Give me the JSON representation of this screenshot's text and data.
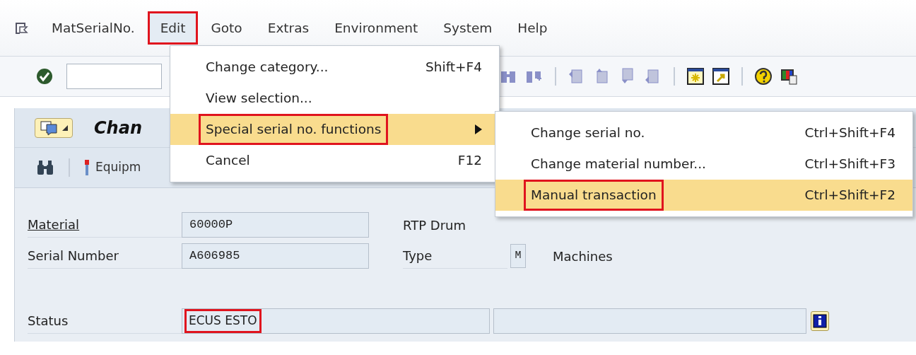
{
  "menu_bar": [
    {
      "label": "MatSerialNo.",
      "open": false
    },
    {
      "label": "Edit",
      "open": true,
      "annotated": true
    },
    {
      "label": "Goto",
      "open": false
    },
    {
      "label": "Extras",
      "open": false
    },
    {
      "label": "Environment",
      "open": false
    },
    {
      "label": "System",
      "open": false
    },
    {
      "label": "Help",
      "open": false
    }
  ],
  "title": "Chan",
  "app_toolbar": {
    "button": "Equipm"
  },
  "form": {
    "rows": [
      {
        "label": "Material",
        "underlined": true,
        "value": "60000P",
        "side_label": "RTP Drum"
      },
      {
        "label": "Serial Number",
        "underlined": false,
        "value": "A606985",
        "side_label": "Type",
        "code": "M",
        "code_text": "Machines"
      }
    ],
    "status": {
      "label": "Status",
      "value": "ECUS ESTO",
      "annotated": true
    }
  },
  "edit_menu": [
    {
      "label": "Change category...",
      "shortcut": "Shift+F4",
      "selected": false,
      "annotated": false,
      "submenu": false
    },
    {
      "label": "View selection...",
      "selected": false,
      "annotated": false,
      "submenu": false
    },
    {
      "label": "Special serial no. functions",
      "selected": true,
      "annotated": true,
      "submenu": true
    },
    {
      "label": "Cancel",
      "shortcut": "F12",
      "selected": false,
      "annotated": false,
      "submenu": false
    }
  ],
  "submenu": [
    {
      "label": "Change serial no.",
      "shortcut": "Ctrl+Shift+F4",
      "selected": false,
      "annotated": false
    },
    {
      "label": "Change material number...",
      "shortcut": "Ctrl+Shift+F3",
      "selected": false,
      "annotated": false
    },
    {
      "label": "Manual transaction",
      "shortcut": "Ctrl+Shift+F2",
      "selected": true,
      "annotated": true
    }
  ]
}
